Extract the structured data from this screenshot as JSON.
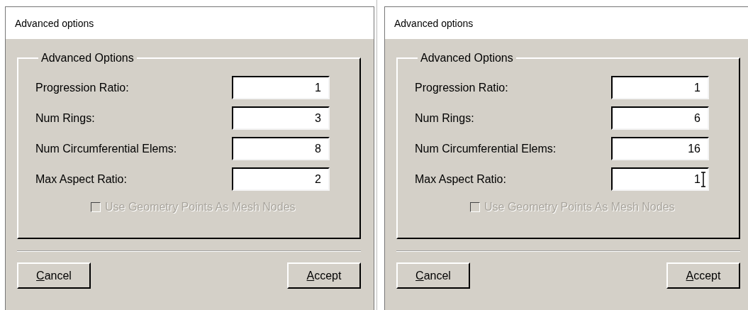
{
  "dialogs": [
    {
      "title": "Advanced options",
      "group": {
        "title": "Advanced Options",
        "fields": [
          {
            "label": "Progression Ratio:",
            "value": "1",
            "cursor": false
          },
          {
            "label": "Num Rings:",
            "value": "3",
            "cursor": false
          },
          {
            "label": "Num Circumferential Elems:",
            "value": "8",
            "cursor": false
          },
          {
            "label": "Max Aspect Ratio:",
            "value": "2",
            "cursor": false
          }
        ],
        "checkbox": {
          "label": "Use Geometry Points As Mesh Nodes",
          "checked": false,
          "disabled": true
        }
      },
      "buttons": [
        "Cancel",
        "Accept"
      ]
    },
    {
      "title": "Advanced options",
      "group": {
        "title": "Advanced Options",
        "fields": [
          {
            "label": "Progression Ratio:",
            "value": "1",
            "cursor": false
          },
          {
            "label": "Num Rings:",
            "value": "6",
            "cursor": false
          },
          {
            "label": "Num Circumferential Elems:",
            "value": "16",
            "cursor": false
          },
          {
            "label": "Max Aspect Ratio:",
            "value": "1",
            "cursor": true
          }
        ],
        "checkbox": {
          "label": "Use Geometry Points As Mesh Nodes",
          "checked": false,
          "disabled": true
        }
      },
      "buttons": [
        "Cancel",
        "Accept"
      ]
    }
  ]
}
